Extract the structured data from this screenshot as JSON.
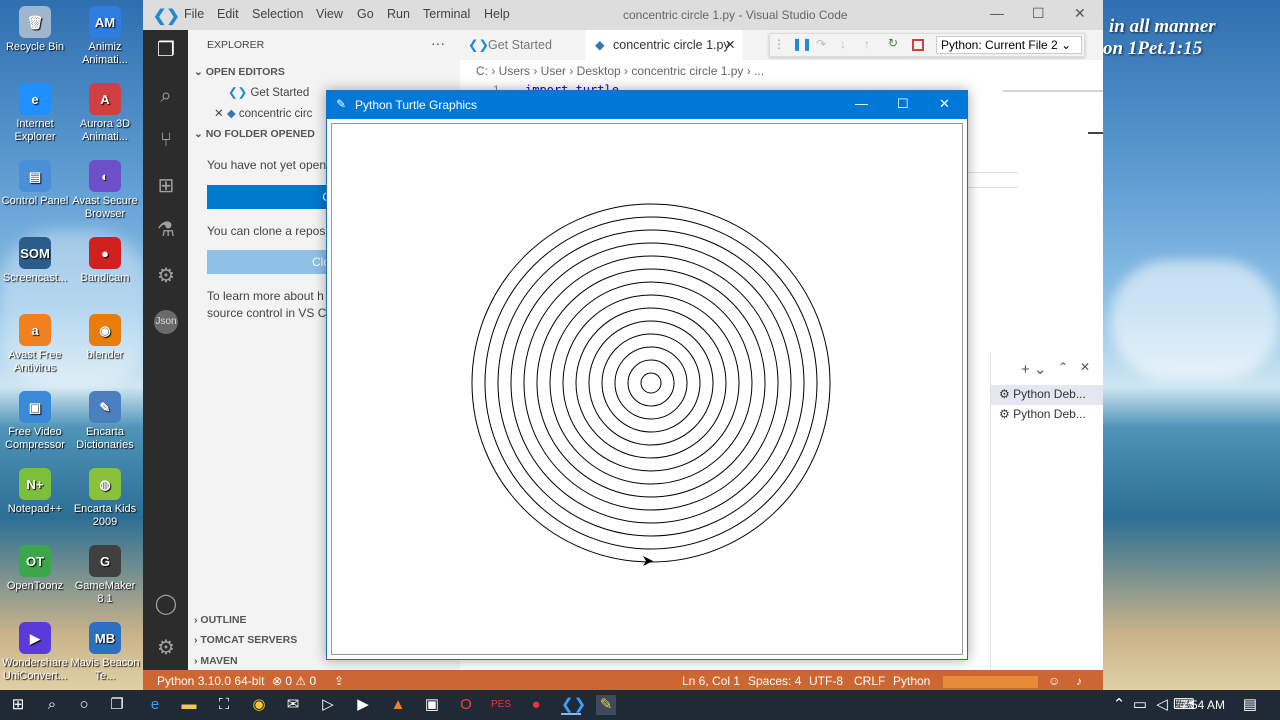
{
  "desktop": {
    "verse_line1": "in all manner",
    "verse_line2": "on 1Pet.1:15",
    "icons": [
      {
        "label": "Recycle Bin",
        "glyph": "🗑",
        "color": "#9fb6cc"
      },
      {
        "label": "Animiz Animati...",
        "glyph": "AM",
        "color": "#2f7de0"
      },
      {
        "label": "Internet Explorer",
        "glyph": "e",
        "color": "#1e90ff"
      },
      {
        "label": "Aurora 3D Animati...",
        "glyph": "A",
        "color": "#d04040"
      },
      {
        "label": "Control Panel",
        "glyph": "▤",
        "color": "#4a8fd8"
      },
      {
        "label": "Avast Secure Browser",
        "glyph": "◐",
        "color": "#6d4fc8"
      },
      {
        "label": "Screencast...",
        "glyph": "SOM",
        "color": "#2b5c8a"
      },
      {
        "label": "Bandicam",
        "glyph": "●",
        "color": "#d02020"
      },
      {
        "label": "Avast Free Antivirus",
        "glyph": "a",
        "color": "#f08020"
      },
      {
        "label": "blender",
        "glyph": "◉",
        "color": "#e87d0d"
      },
      {
        "label": "Free Video Compressor",
        "glyph": "▣",
        "color": "#3a8ad8"
      },
      {
        "label": "Encarta Dictionaries",
        "glyph": "✎",
        "color": "#4a7fc0"
      },
      {
        "label": "Notepad++",
        "glyph": "N+",
        "color": "#7bbf3a"
      },
      {
        "label": "Encarta Kids 2009",
        "glyph": "◍",
        "color": "#8ac03a"
      },
      {
        "label": "OpenToonz",
        "glyph": "OT",
        "color": "#3aa84a"
      },
      {
        "label": "GameMaker 8.1",
        "glyph": "G",
        "color": "#404040"
      },
      {
        "label": "Wondershare UniConvert...",
        "glyph": "▶",
        "color": "#5a3ad8"
      },
      {
        "label": "Mavis Beacon Te...",
        "glyph": "MB",
        "color": "#2f6fc0"
      }
    ]
  },
  "vscode": {
    "menu": [
      "File",
      "Edit",
      "Selection",
      "View",
      "Go",
      "Run",
      "Terminal",
      "Help"
    ],
    "title": "concentric circle 1.py - Visual Studio Code",
    "sidebar": {
      "explorer_label": "EXPLORER",
      "open_editors_label": "OPEN EDITORS",
      "open_editor_1": "Get Started",
      "open_editor_2": "concentric circ",
      "no_folder_label": "NO FOLDER OPENED",
      "no_folder_text": "You have not yet open",
      "open_folder_button": "Open",
      "clone_text": "You can clone a reposi",
      "clone_button": "Clone Re",
      "learn_text_1": "To learn more about h",
      "learn_text_2": "source control in VS C",
      "outline_label": "OUTLINE",
      "tomcat_label": "TOMCAT SERVERS",
      "maven_label": "MAVEN"
    },
    "tabs": [
      {
        "label": "Get Started"
      },
      {
        "label": "concentric circle 1.py"
      }
    ],
    "debug_config": "Python: Current File 2",
    "breadcrumb": "C: › Users › User › Desktop › concentric circle 1.py › ...",
    "editor_line_number": "1",
    "editor_code": "import turtle",
    "panel": {
      "item_1": "Python Deb...",
      "item_2": "Python Deb..."
    },
    "status": {
      "python": "Python 3.10.0 64-bit",
      "problems": "⊗ 0 ⚠ 0",
      "position": "Ln 6, Col 1",
      "spaces": "Spaces: 4",
      "encoding": "UTF-8",
      "eol": "CRLF",
      "language": "Python"
    }
  },
  "turtle": {
    "title": "Python Turtle Graphics",
    "circle_count": 14
  },
  "taskbar": {
    "time": "7:54 AM"
  }
}
